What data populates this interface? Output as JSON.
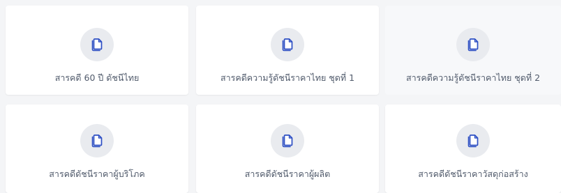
{
  "colors": {
    "background": "#f4f5f7",
    "card": "#ffffff",
    "icon_circle": "#e9ebef",
    "icon_accent": "#2d4fc4",
    "text": "#505a6b"
  },
  "cards": [
    {
      "label": "สารคดี 60 ปี ดัชนีไทย",
      "icon": "file-copy-icon"
    },
    {
      "label": "สารคดีความรู้ดัชนีราคาไทย ชุดที่ 1",
      "icon": "file-copy-icon"
    },
    {
      "label": "สารคดีความรู้ดัชนีราคาไทย ชุดที่ 2",
      "icon": "file-copy-icon"
    },
    {
      "label": "สารคดีดัชนีราคาผู้บริโภค",
      "icon": "file-copy-icon"
    },
    {
      "label": "สารคดีดัชนีราคาผู้ผลิต",
      "icon": "file-copy-icon"
    },
    {
      "label": "สารคดีดัชนีราคาวัสดุก่อสร้าง",
      "icon": "file-copy-icon"
    }
  ]
}
